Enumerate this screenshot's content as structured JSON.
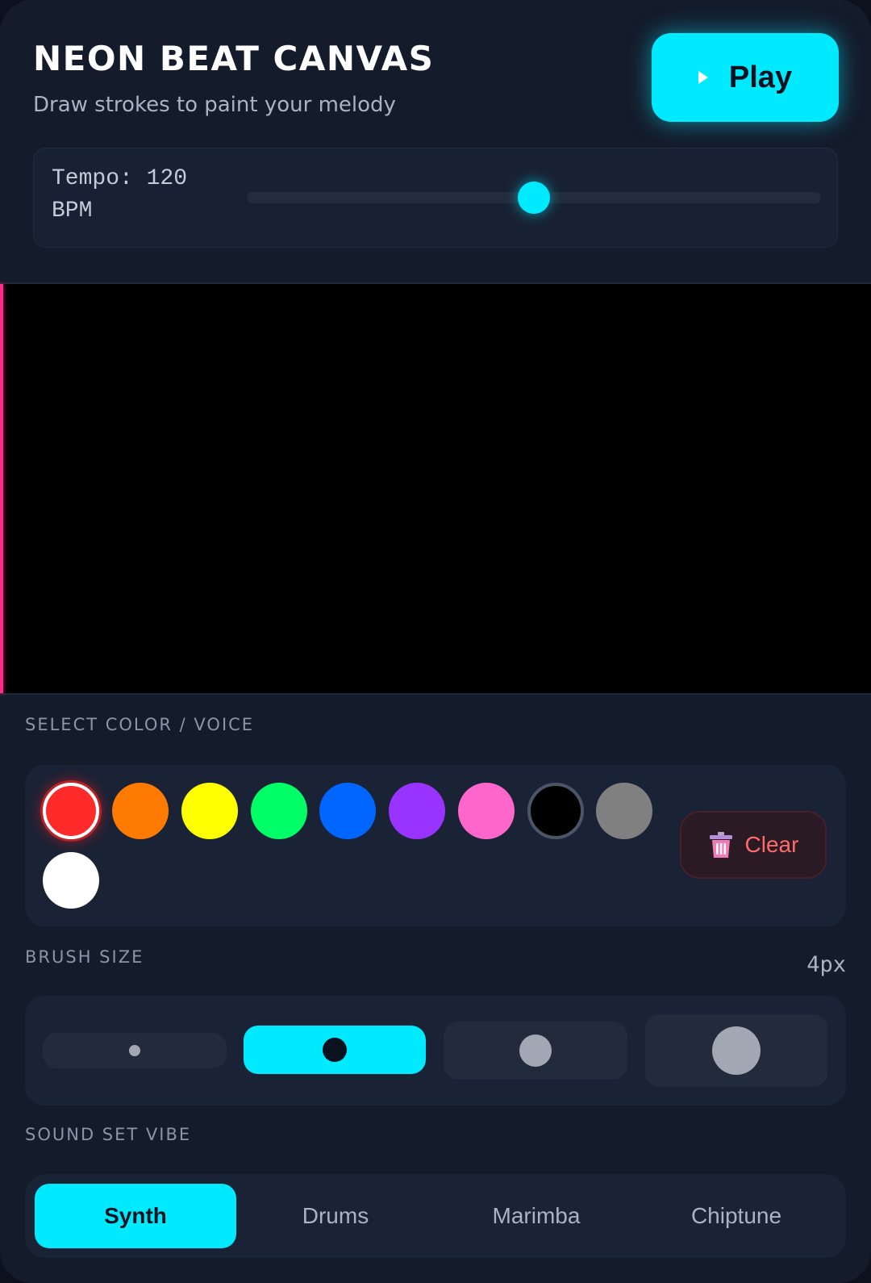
{
  "header": {
    "title": "NEON BEAT CANVAS",
    "subtitle": "Draw strokes to paint your melody",
    "play_label": "Play"
  },
  "tempo": {
    "label_line1": "Tempo: 120",
    "label_line2": "BPM",
    "value": 120,
    "slider_fraction": 0.5
  },
  "colors": {
    "section_label": "SELECT COLOR / VOICE",
    "selected": "red",
    "swatches": [
      {
        "name": "red",
        "hex": "#ff2a2a"
      },
      {
        "name": "orange",
        "hex": "#ff7a00"
      },
      {
        "name": "yellow",
        "hex": "#ffff00"
      },
      {
        "name": "green",
        "hex": "#00ff66"
      },
      {
        "name": "blue",
        "hex": "#0066ff"
      },
      {
        "name": "purple",
        "hex": "#9933ff"
      },
      {
        "name": "pink",
        "hex": "#ff66cc"
      },
      {
        "name": "black",
        "hex": "#000000"
      },
      {
        "name": "gray",
        "hex": "#808080"
      },
      {
        "name": "white",
        "hex": "#ffffff"
      }
    ],
    "clear_label": "Clear"
  },
  "brush": {
    "section_label": "BRUSH SIZE",
    "value_label": "4px",
    "selected_index": 1
  },
  "sound": {
    "section_label": "SOUND SET VIBE",
    "options": [
      "Synth",
      "Drums",
      "Marimba",
      "Chiptune"
    ],
    "selected": "Synth"
  },
  "theme": {
    "accent": "#00eaff",
    "playhead": "#ff2d86",
    "danger": "#ff6b6b"
  }
}
